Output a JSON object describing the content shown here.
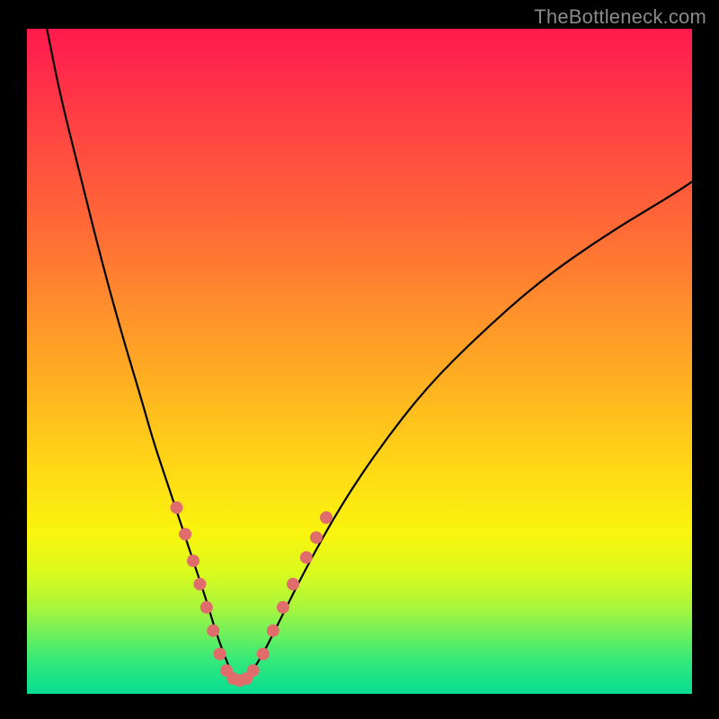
{
  "watermark": "TheBottleneck.com",
  "chart_data": {
    "type": "line",
    "title": "",
    "xlabel": "",
    "ylabel": "",
    "xlim": [
      0,
      100
    ],
    "ylim": [
      0,
      100
    ],
    "grid": false,
    "series": [
      {
        "name": "bottleneck-curve",
        "x": [
          3,
          5,
          8,
          11,
          14,
          17,
          19,
          21,
          23,
          25,
          27,
          28.5,
          30,
          31,
          32,
          33,
          35,
          38,
          42,
          47,
          53,
          60,
          68,
          77,
          87,
          97,
          100
        ],
        "y": [
          100,
          90,
          78,
          66,
          55,
          45,
          38,
          32,
          26,
          20,
          14,
          9,
          5,
          2.5,
          2,
          2.5,
          5,
          11,
          19,
          28,
          37,
          46,
          54,
          62,
          69,
          75,
          77
        ]
      }
    ],
    "markers": {
      "name": "highlight-dots",
      "color": "#e06c6c",
      "points": [
        {
          "x": 22.5,
          "y": 28
        },
        {
          "x": 23.8,
          "y": 24
        },
        {
          "x": 25.0,
          "y": 20
        },
        {
          "x": 26.0,
          "y": 16.5
        },
        {
          "x": 27.0,
          "y": 13
        },
        {
          "x": 28.0,
          "y": 9.5
        },
        {
          "x": 29.0,
          "y": 6
        },
        {
          "x": 30.0,
          "y": 3.5
        },
        {
          "x": 31.0,
          "y": 2.3
        },
        {
          "x": 32.0,
          "y": 2.0
        },
        {
          "x": 33.0,
          "y": 2.3
        },
        {
          "x": 34.0,
          "y": 3.5
        },
        {
          "x": 35.5,
          "y": 6
        },
        {
          "x": 37.0,
          "y": 9.5
        },
        {
          "x": 38.5,
          "y": 13
        },
        {
          "x": 40.0,
          "y": 16.5
        },
        {
          "x": 42.0,
          "y": 20.5
        },
        {
          "x": 43.5,
          "y": 23.5
        },
        {
          "x": 45.0,
          "y": 26.5
        }
      ]
    }
  }
}
